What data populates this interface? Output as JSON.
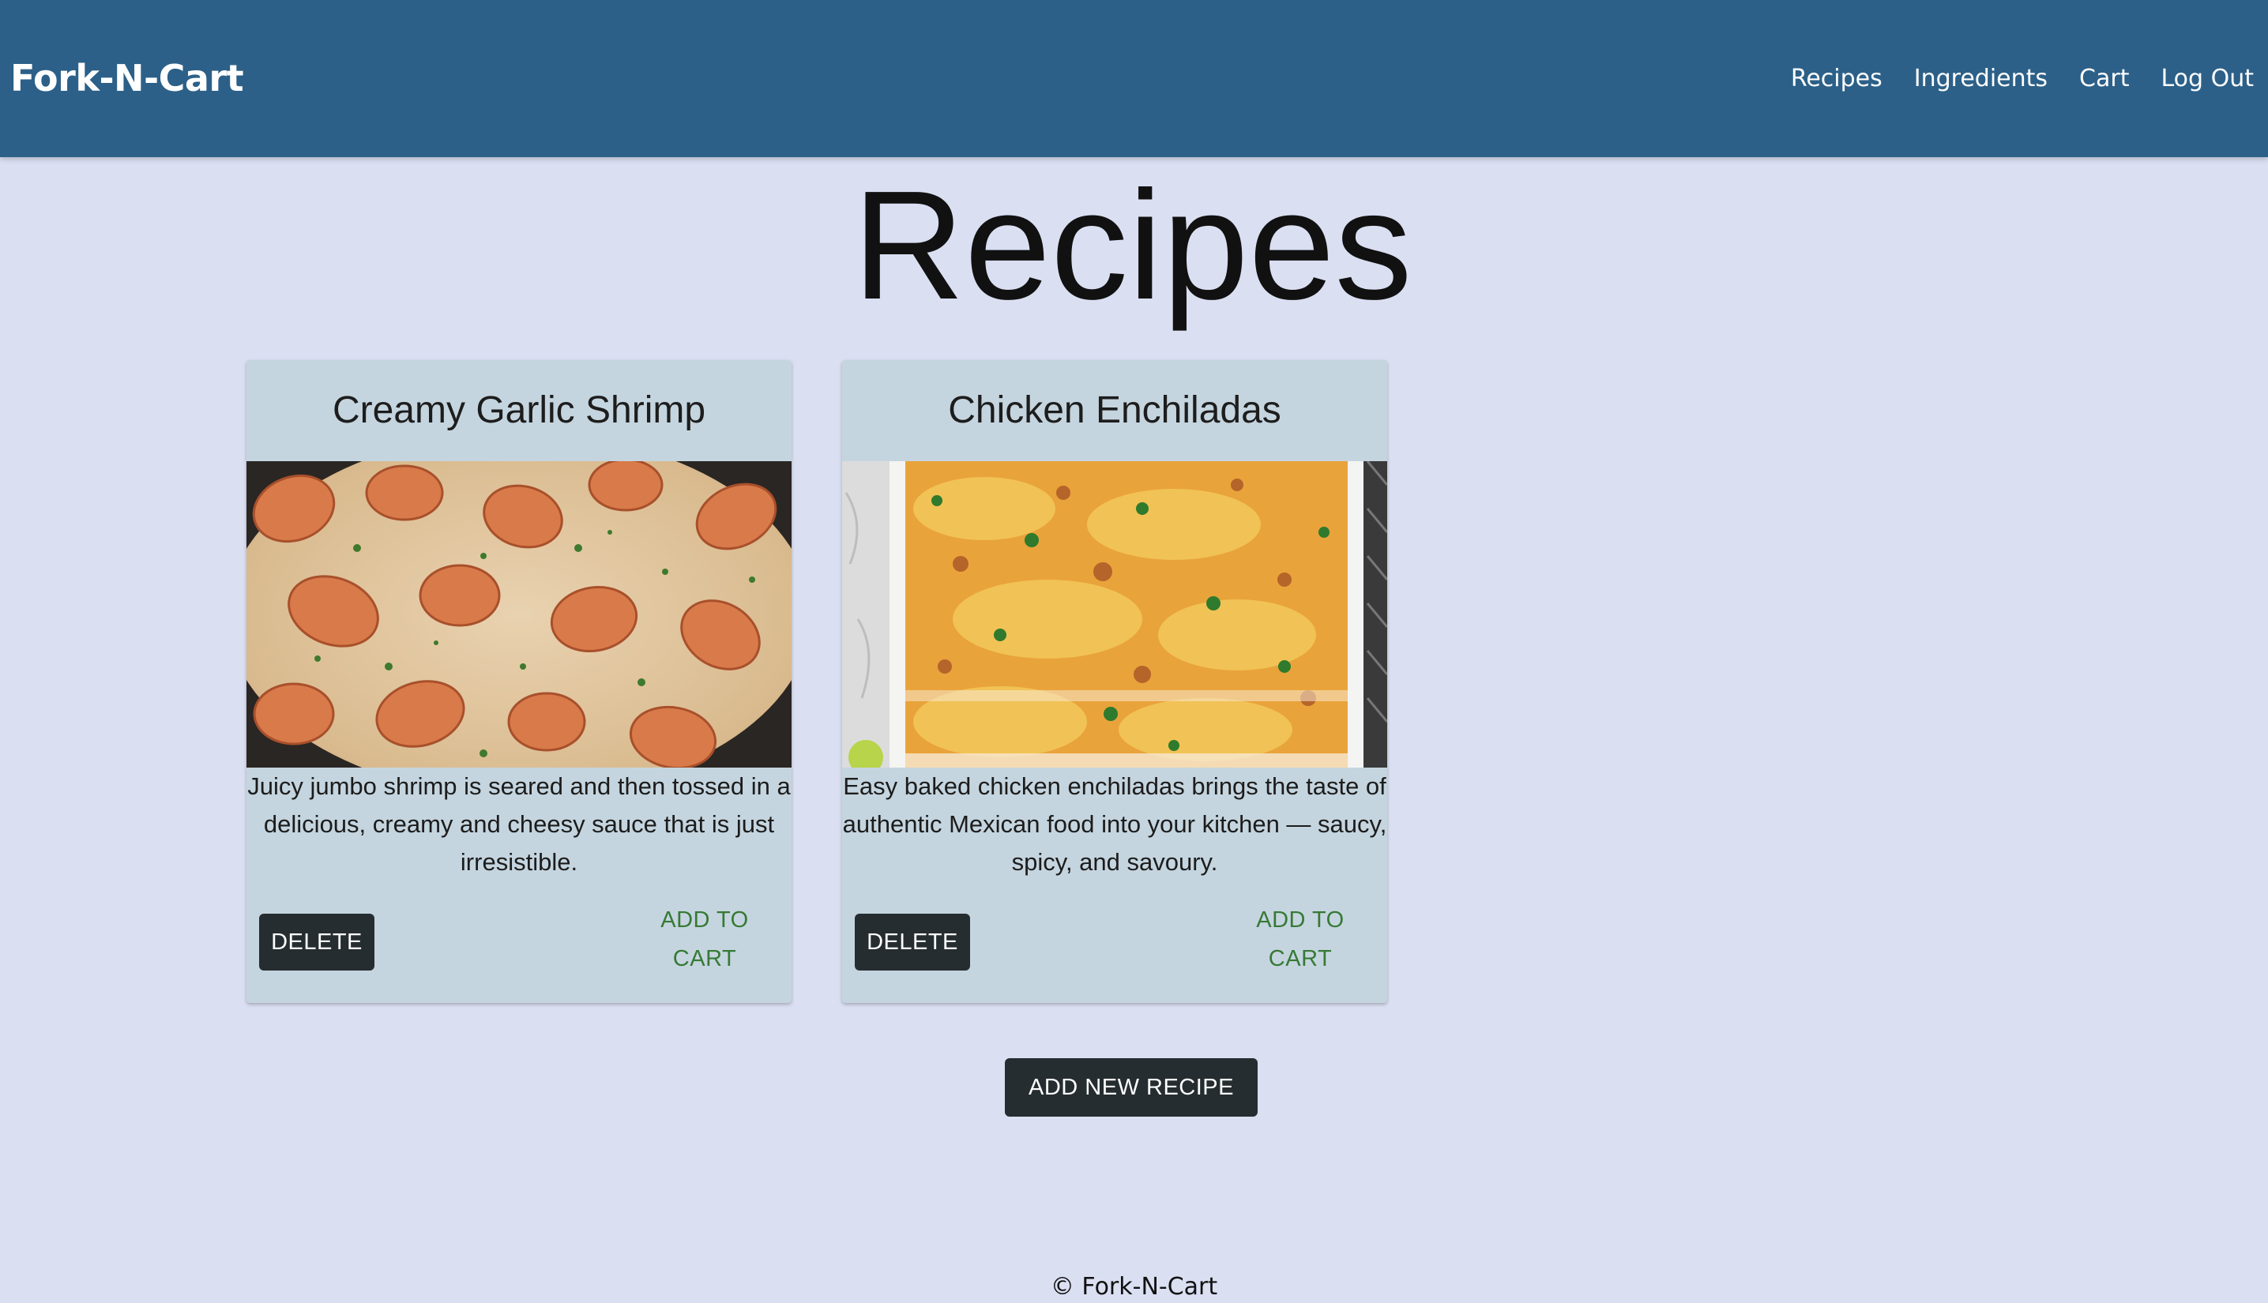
{
  "header": {
    "brand": "Fork-N-Cart",
    "nav": [
      {
        "label": "Recipes"
      },
      {
        "label": "Ingredients"
      },
      {
        "label": "Cart"
      },
      {
        "label": "Log Out"
      }
    ],
    "background_color": "#2c6088"
  },
  "main": {
    "title": "Recipes",
    "recipes": [
      {
        "title": "Creamy Garlic Shrimp",
        "description": "Juicy jumbo shrimp is seared and then tossed in a delicious, creamy and cheesy sauce that is just irresistible.",
        "delete_label": "DELETE",
        "add_to_cart_label": "ADD TO\nCART",
        "image": "creamy-garlic-shrimp-photo"
      },
      {
        "title": "Chicken Enchiladas",
        "description": "Easy baked chicken enchiladas brings the taste of authentic Mexican food into your kitchen — saucy, spicy, and savoury.",
        "delete_label": "DELETE",
        "add_to_cart_label": "ADD TO\nCART",
        "image": "chicken-enchiladas-photo"
      }
    ],
    "add_recipe_label": "ADD NEW RECIPE"
  },
  "footer": {
    "text": "© Fork-N-Cart"
  },
  "colors": {
    "page_background": "#dadff2",
    "card_background": "#c5d5df",
    "dark_button": "#262d31",
    "cart_text": "#367a35"
  }
}
